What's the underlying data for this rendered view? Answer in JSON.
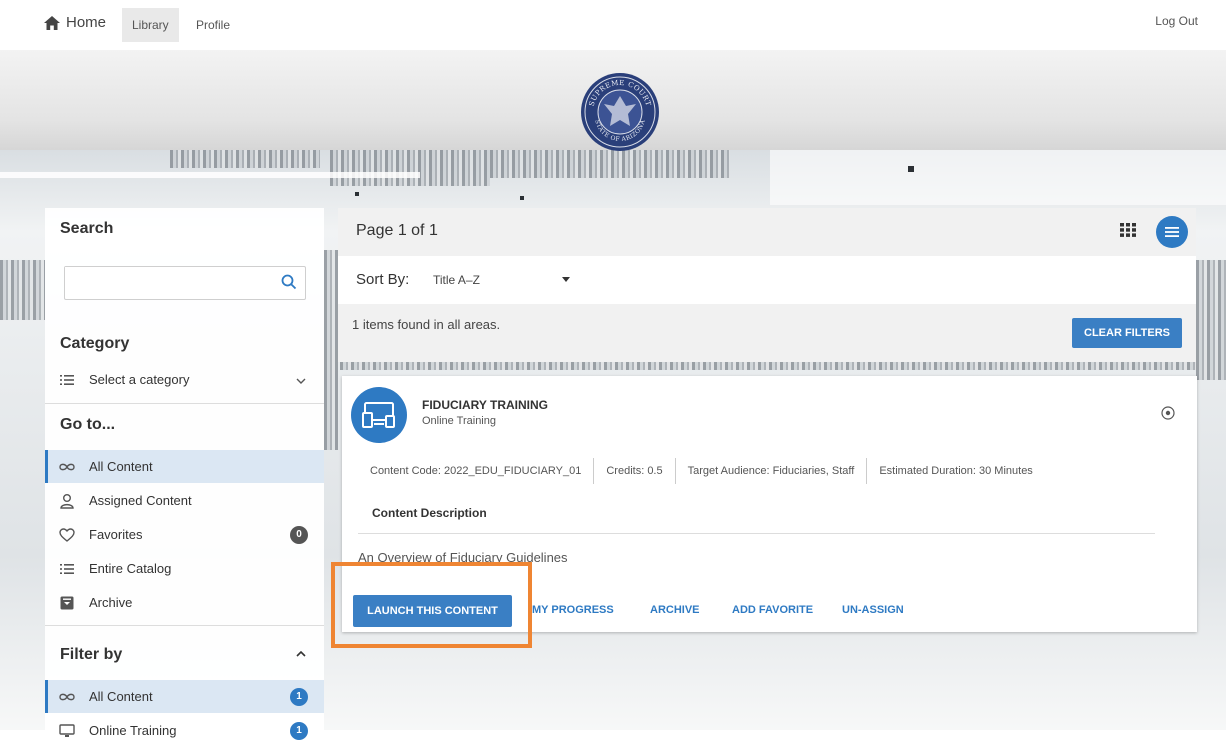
{
  "nav": {
    "home": "Home",
    "tabs": [
      {
        "label": "Library",
        "active": true
      },
      {
        "label": "Profile",
        "active": false
      }
    ],
    "logout": "Log Out"
  },
  "seal": {
    "top_text": "SUPREME COURT",
    "bottom_text": "STATE OF ARIZONA"
  },
  "sidebar": {
    "search": {
      "title": "Search",
      "value": "",
      "placeholder": ""
    },
    "category": {
      "title": "Category",
      "placeholder": "Select a category"
    },
    "goto": {
      "title": "Go to...",
      "items": [
        {
          "label": "All Content",
          "icon": "infinity-icon",
          "selected": true
        },
        {
          "label": "Assigned Content",
          "icon": "user-icon"
        },
        {
          "label": "Favorites",
          "icon": "heart-icon",
          "badge": "0"
        },
        {
          "label": "Entire Catalog",
          "icon": "list-icon"
        },
        {
          "label": "Archive",
          "icon": "archive-icon"
        }
      ]
    },
    "filter": {
      "title": "Filter by",
      "items": [
        {
          "label": "All Content",
          "icon": "infinity-icon",
          "badge": "1",
          "selected": true
        },
        {
          "label": "Online Training",
          "icon": "monitor-icon",
          "badge": "1"
        }
      ]
    }
  },
  "main": {
    "page_label": "Page 1 of 1",
    "sort": {
      "label": "Sort By:",
      "value": "Title A–Z"
    },
    "found_text": "1 items found in all areas.",
    "clear_filters": "CLEAR FILTERS",
    "card": {
      "title": "FIDUCIARY TRAINING",
      "subtitle": "Online Training",
      "meta": [
        "Content Code: 2022_EDU_FIDUCIARY_01",
        "Credits: 0.5",
        "Target Audience: Fiduciaries, Staff",
        "Estimated Duration: 30 Minutes"
      ],
      "desc_heading": "Content Description",
      "desc_text": "An Overview of Fiduciary Guidelines",
      "actions": {
        "launch": "LAUNCH THIS CONTENT",
        "progress": "MY PROGRESS",
        "archive": "ARCHIVE",
        "favorite": "ADD FAVORITE",
        "unassign": "UN-ASSIGN"
      }
    }
  },
  "colors": {
    "accent": "#2e7ac3",
    "button": "#3a7fc4",
    "highlight": "#ef8533",
    "selected_row": "#dbe7f3"
  }
}
